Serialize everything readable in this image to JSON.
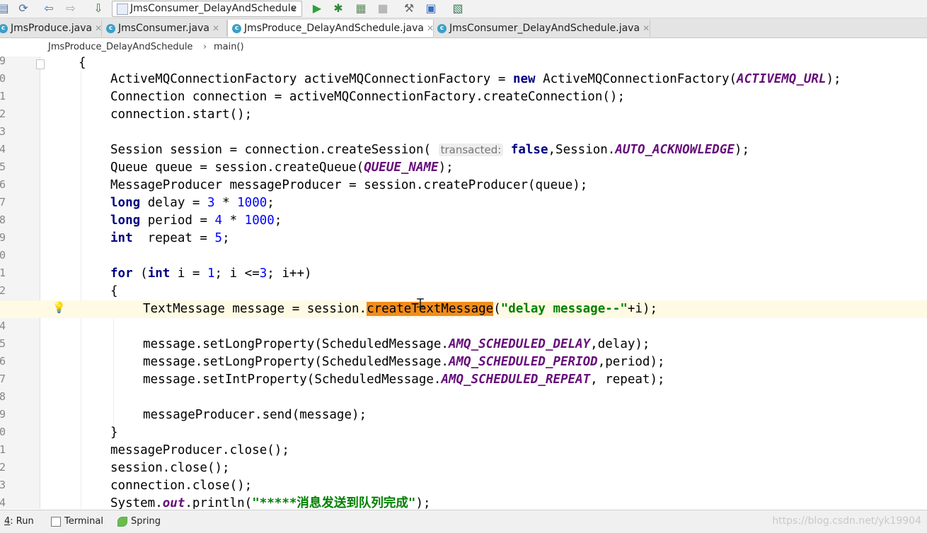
{
  "toolbar": {
    "run_config": "JmsConsumer_DelayAndSchedule",
    "icons": [
      "save-icon",
      "sync-icon",
      "back-icon",
      "forward-icon",
      "build-icon",
      "run-icon",
      "debug-icon",
      "coverage-icon",
      "stop-icon",
      "project-structure-icon",
      "sdk-icon",
      "tasks-icon"
    ]
  },
  "tabs": [
    {
      "label": "JmsProduce.java",
      "active": false
    },
    {
      "label": "JmsConsumer.java",
      "active": false
    },
    {
      "label": "JmsProduce_DelayAndSchedule.java",
      "active": true
    },
    {
      "label": "JmsConsumer_DelayAndSchedule.java",
      "active": false
    }
  ],
  "breadcrumb": {
    "class_name": "JmsProduce_DelayAndSchedule",
    "separator": "›",
    "method": "main()"
  },
  "gutter": {
    "line_numbers": [
      "9",
      "0",
      "1",
      "2",
      "3",
      "4",
      "5",
      "6",
      "7",
      "8",
      "9",
      "0",
      "1",
      "2",
      "3",
      "4",
      "5",
      "6",
      "7",
      "8",
      "9",
      "0",
      "1",
      "2",
      "3",
      "4"
    ]
  },
  "code": {
    "l0_brace": "{",
    "l1_a": "ActiveMQConnectionFactory activeMQConnectionFactory = ",
    "l1_new": "new",
    "l1_b": " ActiveMQConnectionFactory(",
    "l1_const": "ACTIVEMQ_URL",
    "l1_c": ");",
    "l2": "Connection connection = activeMQConnectionFactory.createConnection();",
    "l3": "connection.start();",
    "l5_a": "Session session = connection.createSession( ",
    "l5_hint": "transacted:",
    "l5_false": "false",
    "l5_b": ",Session.",
    "l5_const": "AUTO_ACKNOWLEDGE",
    "l5_c": ");",
    "l6_a": "Queue queue = session.createQueue(",
    "l6_const": "QUEUE_NAME",
    "l6_b": ");",
    "l7": "MessageProducer messageProducer = session.createProducer(queue);",
    "l8_kw": "long",
    "l8_a": " delay = ",
    "l8_n1": "3",
    "l8_b": " * ",
    "l8_n2": "1000",
    "l8_c": ";",
    "l9_kw": "long",
    "l9_a": " period = ",
    "l9_n1": "4",
    "l9_b": " * ",
    "l9_n2": "1000",
    "l9_c": ";",
    "l10_kw": "int",
    "l10_a": "  repeat = ",
    "l10_n": "5",
    "l10_b": ";",
    "l12_for": "for",
    "l12_a": " (",
    "l12_int": "int",
    "l12_b": " i = ",
    "l12_n1": "1",
    "l12_c": "; i <=",
    "l12_n2": "3",
    "l12_d": "; i++)",
    "l13": "{",
    "l14_a": "TextMessage message = session.",
    "l14_hl": "createTextMessage",
    "l14_b": "(",
    "l14_str": "\"delay message--\"",
    "l14_c": "+i);",
    "l16_a": "message.setLongProperty(ScheduledMessage.",
    "l16_const": "AMQ_SCHEDULED_DELAY",
    "l16_b": ",delay);",
    "l17_a": "message.setLongProperty(ScheduledMessage.",
    "l17_const": "AMQ_SCHEDULED_PERIOD",
    "l17_b": ",period);",
    "l18_a": "message.setIntProperty(ScheduledMessage.",
    "l18_const": "AMQ_SCHEDULED_REPEAT",
    "l18_b": ", repeat);",
    "l20": "messageProducer.send(message);",
    "l21": "}",
    "l22": "messageProducer.close();",
    "l23": "session.close();",
    "l24": "connection.close();",
    "l25_a": "System.",
    "l25_out": "out",
    "l25_b": ".println(",
    "l25_str": "\"*****消息发送到队列完成\"",
    "l25_c": ");"
  },
  "bottom": {
    "run_num": "4",
    "run_label": ": Run",
    "terminal_label": "Terminal",
    "spring_label": "Spring",
    "watermark": "https://blog.csdn.net/yk19904"
  }
}
